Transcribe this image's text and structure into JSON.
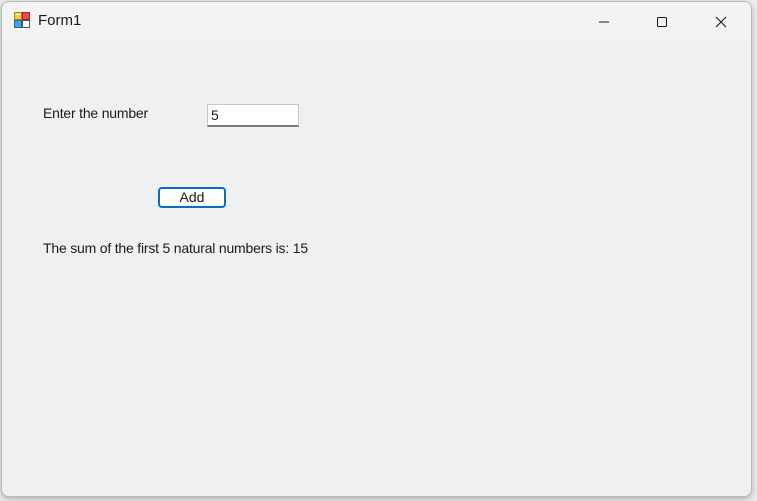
{
  "window": {
    "title": "Form1",
    "icon": "winforms-app-icon"
  },
  "caption_buttons": {
    "minimize_icon": "minimize-icon",
    "maximize_icon": "maximize-icon",
    "close_icon": "close-icon"
  },
  "form": {
    "prompt_label": "Enter the number",
    "number_input_value": "5",
    "add_button_label": "Add",
    "result_text": "The sum of the first 5 natural numbers is: 15"
  },
  "colors": {
    "button_focus_border": "#0f6cbd",
    "form_background": "#f0f0f0"
  }
}
